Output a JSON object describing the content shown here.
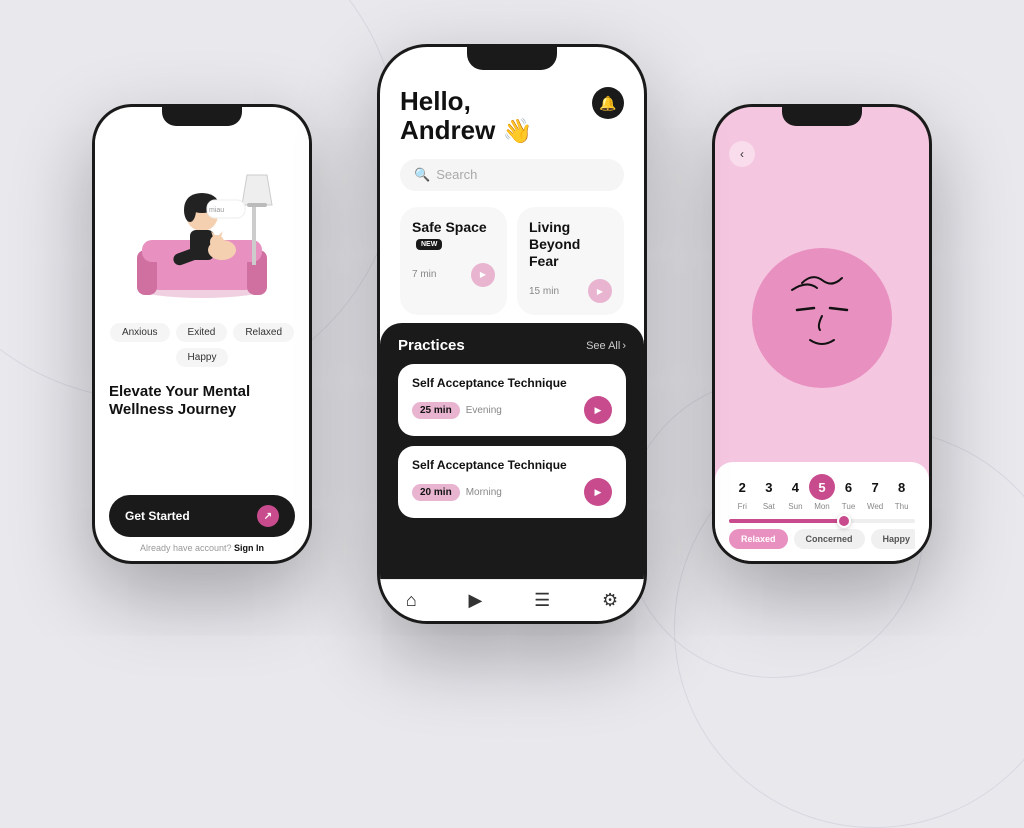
{
  "background": "#e8e8ed",
  "phones": {
    "left": {
      "moods": [
        "Anxious",
        "Exited",
        "Relaxed",
        "Happy"
      ],
      "title": "Elevate Your Mental Wellness Journey",
      "get_started": "Get Started",
      "sign_in_text": "Already have account?",
      "sign_in_link": "Sign In"
    },
    "center": {
      "greeting": "Hello,",
      "name": "Andrew",
      "emoji": "👋",
      "search_placeholder": "Search",
      "card1": {
        "title": "Safe Space",
        "badge": "NEW",
        "duration": "7 min"
      },
      "card2": {
        "title": "Living Beyond Fear",
        "duration": "15 min"
      },
      "practices": {
        "title": "Practices",
        "see_all": "See All",
        "items": [
          {
            "title": "Self Acceptance Technique",
            "duration": "25 min",
            "time": "Evening"
          },
          {
            "title": "Self Acceptance Technique",
            "duration": "20 min",
            "time": "Morning"
          }
        ]
      },
      "nav": [
        "home",
        "play",
        "list",
        "settings"
      ]
    },
    "right": {
      "calendar": {
        "days": [
          {
            "num": "2",
            "label": "Fri"
          },
          {
            "num": "3",
            "label": "Sat"
          },
          {
            "num": "4",
            "label": "Sun"
          },
          {
            "num": "5",
            "label": "Mon",
            "active": true
          },
          {
            "num": "6",
            "label": "Tue"
          },
          {
            "num": "7",
            "label": "Wed"
          },
          {
            "num": "8",
            "label": "Thu"
          }
        ]
      },
      "moods": [
        "Relaxed",
        "Concerned",
        "Happy"
      ],
      "active_mood": "Relaxed"
    }
  }
}
